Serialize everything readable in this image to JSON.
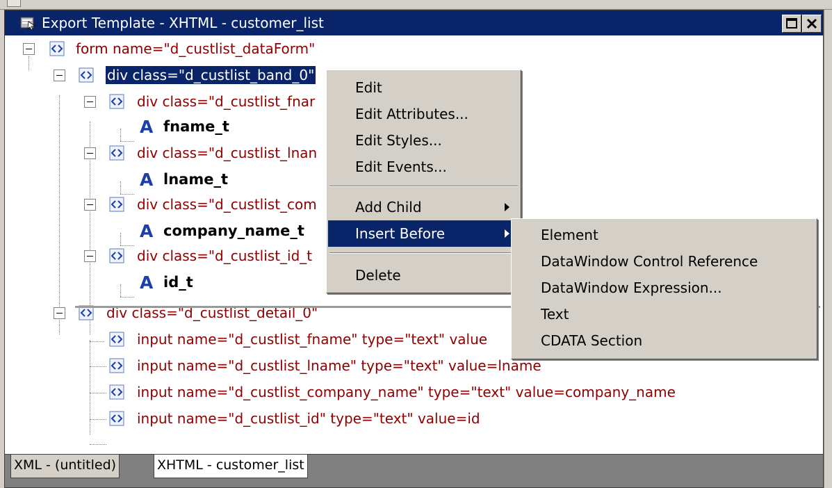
{
  "window": {
    "title": "Export Template - XHTML - customer_list"
  },
  "tree": {
    "root": "form name=\"d_custlist_dataForm\"",
    "band": "div class=\"d_custlist_band_0\"",
    "band_children": [
      {
        "div": "div class=\"d_custlist_fnar",
        "text": "fname_t"
      },
      {
        "div": "div class=\"d_custlist_lnan",
        "text": "lname_t"
      },
      {
        "div": "div class=\"d_custlist_com",
        "text": "company_name_t"
      },
      {
        "div": "div class=\"d_custlist_id_t",
        "text": "id_t"
      }
    ],
    "detail": "div class=\"d_custlist_detail_0\"",
    "detail_children": [
      "input name=\"d_custlist_fname\" type=\"text\" value",
      "input name=\"d_custlist_lname\" type=\"text\" value=lname",
      "input name=\"d_custlist_company_name\" type=\"text\" value=company_name",
      "input name=\"d_custlist_id\" type=\"text\" value=id"
    ]
  },
  "context_menu": {
    "items": [
      "Edit",
      "Edit Attributes...",
      "Edit Styles...",
      "Edit Events...",
      "Add Child",
      "Insert Before",
      "Delete"
    ],
    "highlighted": "Insert Before"
  },
  "submenu": {
    "items": [
      "Element",
      "DataWindow Control Reference",
      "DataWindow Expression...",
      "Text",
      "CDATA Section"
    ]
  },
  "tabs": [
    "XML - (untitled)",
    "XHTML - customer_list"
  ],
  "active_tab": "XHTML - customer_list",
  "colors": {
    "titlebar": "#0a246a",
    "element_text": "#8b0000",
    "selection": "#0a246a",
    "menu_bg": "#d4d0c8"
  }
}
